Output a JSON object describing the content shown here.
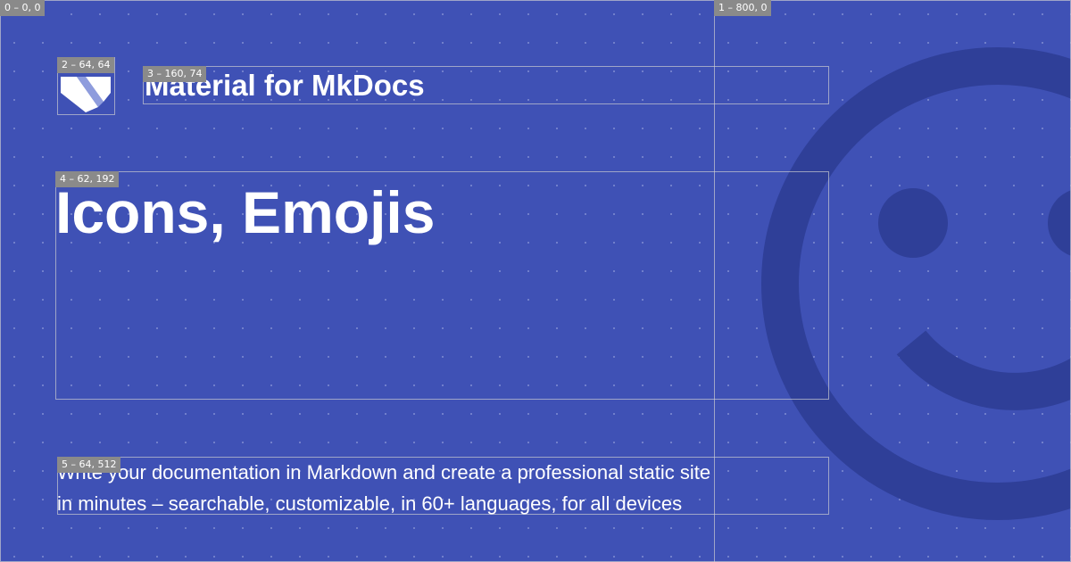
{
  "card": {
    "site_name": "Material for MkDocs",
    "page_title": "Icons, Emojis",
    "description_lines": [
      "Write your documentation in Markdown and create a professional static site",
      "in minutes – searchable, customizable, in 60+ languages, for all devices"
    ],
    "logo_icon": "mkdocs-material-logo-icon",
    "background_icon": "smiley-emoji-icon"
  },
  "colors": {
    "background": "#3f51b5",
    "foreground": "#ffffff",
    "emoji": "#2f3f98",
    "logo_accent": "#8e9cdd"
  },
  "layers": [
    {
      "tag": "0 – 0, 0"
    },
    {
      "tag": "1 – 800, 0"
    },
    {
      "tag": "2 – 64, 64"
    },
    {
      "tag": "3 – 160, 74"
    },
    {
      "tag": "4 – 62, 192"
    },
    {
      "tag": "5 – 64, 512"
    }
  ]
}
